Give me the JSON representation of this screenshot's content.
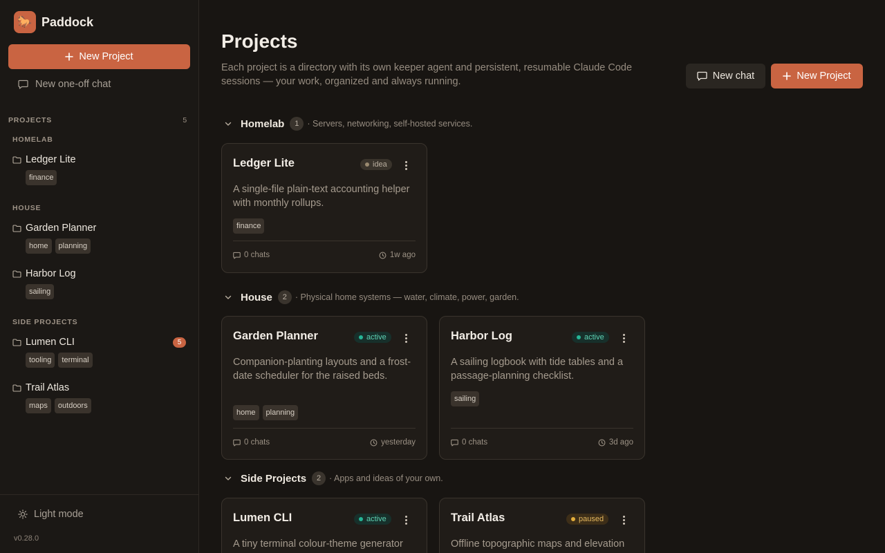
{
  "app": {
    "name": "Paddock",
    "logo_glyph": "🐎",
    "version": "v0.28.0"
  },
  "sidebar": {
    "new_project_label": "New Project",
    "new_chat_label": "New one-off chat",
    "projects_heading": "PROJECTS",
    "projects_count": "5",
    "groups": [
      {
        "label": "HOMELAB",
        "items": [
          {
            "name": "Ledger Lite",
            "tags": [
              "finance"
            ],
            "badge": null
          }
        ]
      },
      {
        "label": "HOUSE",
        "items": [
          {
            "name": "Garden Planner",
            "tags": [
              "home",
              "planning"
            ],
            "badge": null
          },
          {
            "name": "Harbor Log",
            "tags": [
              "sailing"
            ],
            "badge": null
          }
        ]
      },
      {
        "label": "SIDE PROJECTS",
        "items": [
          {
            "name": "Lumen CLI",
            "tags": [
              "tooling",
              "terminal"
            ],
            "badge": "5"
          },
          {
            "name": "Trail Atlas",
            "tags": [
              "maps",
              "outdoors"
            ],
            "badge": null
          }
        ]
      }
    ],
    "theme_toggle_label": "Light mode"
  },
  "main": {
    "title": "Projects",
    "description": "Each project is a directory with its own keeper agent and persistent, resumable Claude Code sessions — your work, organized and always running.",
    "new_chat_label": "New chat",
    "new_project_label": "New Project",
    "groups": [
      {
        "name": "Homelab",
        "count": "1",
        "description": "· Servers, networking, self-hosted services."
      },
      {
        "name": "House",
        "count": "2",
        "description": "· Physical home systems — water, climate, power, garden."
      },
      {
        "name": "Side Projects",
        "count": "2",
        "description": "· Apps and ideas of your own."
      }
    ],
    "cards": [
      {
        "title": "Ledger Lite",
        "status": "idea",
        "description": "A single-file plain-text accounting helper with monthly rollups.",
        "tags": [
          "finance"
        ],
        "chats": "0 chats",
        "updated": "1w ago"
      },
      {
        "title": "Garden Planner",
        "status": "active",
        "description": "Companion-planting layouts and a frost-date scheduler for the raised beds.",
        "tags": [
          "home",
          "planning"
        ],
        "chats": "0 chats",
        "updated": "yesterday"
      },
      {
        "title": "Harbor Log",
        "status": "active",
        "description": "A sailing logbook with tide tables and a passage-planning checklist.",
        "tags": [
          "sailing"
        ],
        "chats": "0 chats",
        "updated": "3d ago"
      },
      {
        "title": "Lumen CLI",
        "status": "active",
        "description": "A tiny terminal colour-theme generator"
      },
      {
        "title": "Trail Atlas",
        "status": "paused",
        "description": "Offline topographic maps and elevation"
      }
    ]
  },
  "colors": {
    "accent": "#c96442",
    "active": "#5fd3b5",
    "paused": "#e3b75e",
    "background": "#181512"
  },
  "icons": [
    "plus-icon",
    "chat-bubble-icon",
    "folder-icon",
    "chevron-down-icon",
    "kebab-menu-icon",
    "clock-icon",
    "sun-icon"
  ]
}
